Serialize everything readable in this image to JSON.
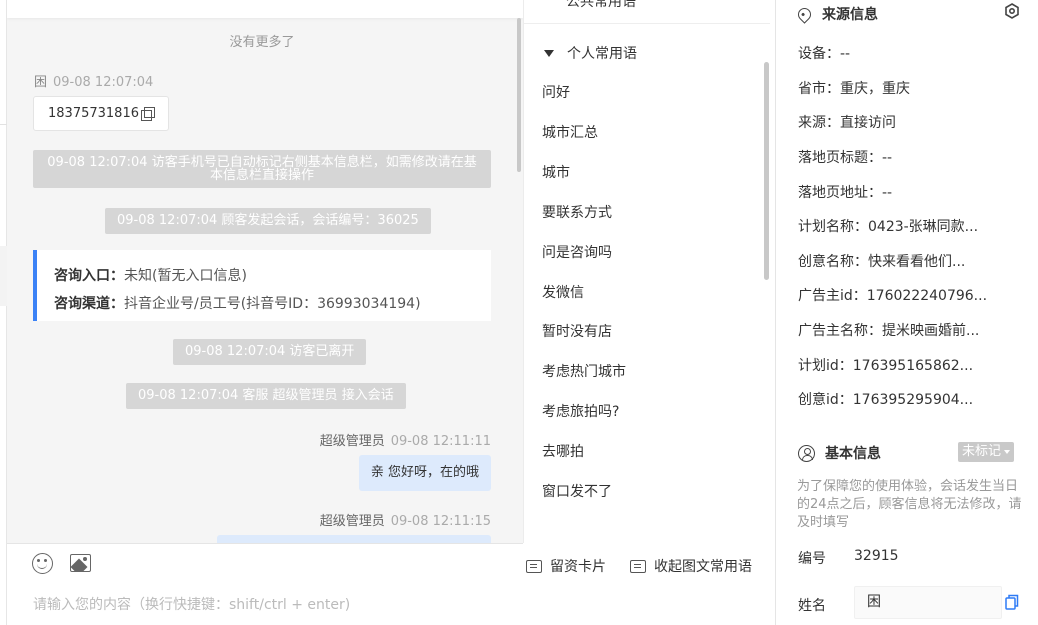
{
  "chat": {
    "no_more": "没有更多了",
    "visitor_name": "困",
    "visitor_time": "09-08 12:07:04",
    "phone": "18375731816",
    "sys_msgs": [
      "09-08 12:07:04 访客手机号已自动标记右侧基本信息栏，如需修改请在基本信息栏直接操作",
      "09-08 12:07:04 顾客发起会话，会话编号：36025",
      "09-08 12:07:04 访客已离开",
      "09-08 12:07:04 客服 超级管理员 接入会话"
    ],
    "card": {
      "entry_label": "咨询入口：",
      "entry_value": "未知(暂无入口信息)",
      "channel_label": "咨询渠道：",
      "channel_value": "抖音企业号/员工号(抖音号ID：36993034194)"
    },
    "agent_name": "超级管理员",
    "agent_time_1": "09-08 12:11:11",
    "agent_msg_1": "亲 您好呀，在的哦",
    "agent_time_2": "09-08 12:11:15"
  },
  "input": {
    "placeholder": "请输入您的内容（换行快捷键：shift/ctrl + enter)",
    "tool_card": "留资卡片",
    "tool_collect": "收起图文常用语"
  },
  "phrases": {
    "top_cut": "公共常用语",
    "group_title": "个人常用语",
    "items": [
      "问好",
      "城市汇总",
      "城市",
      "要联系方式",
      "问是咨询吗",
      "发微信",
      "暂时没有店",
      "考虑热门城市",
      "考虑旅拍吗?",
      "去哪拍",
      "窗口发不了"
    ]
  },
  "source": {
    "title": "来源信息",
    "rows": [
      "设备：--",
      "省市：重庆，重庆",
      "来源：直接访问",
      "落地页标题：--",
      "落地页地址：--",
      "计划名称：0423-张琳同款...",
      "创意名称：快来看看他们...",
      "广告主id：176022240796...",
      "广告主名称：提米映画婚前...",
      "计划id：176395165862...",
      "创意id：176395295904..."
    ]
  },
  "basic": {
    "title": "基本信息",
    "tag": "未标记",
    "hint": "为了保障您的使用体验，会话发生当日的24点之后，顾客信息将无法修改，请及时填写",
    "id_label": "编号",
    "id_value": "32915",
    "name_label": "姓名",
    "name_value": "困"
  }
}
